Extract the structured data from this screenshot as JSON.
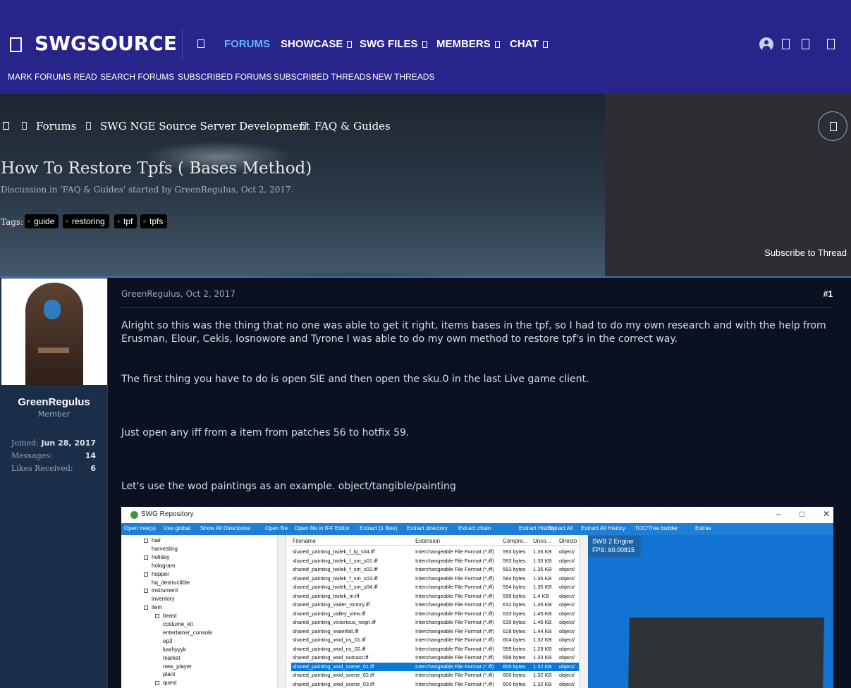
{
  "header": {
    "logo": "SWGSOURCE",
    "nav": [
      {
        "label": "FORUMS",
        "active": true,
        "has_menu": false
      },
      {
        "label": "SHOWCASE",
        "active": false,
        "has_menu": true
      },
      {
        "label": "SWG FILES",
        "active": false,
        "has_menu": true
      },
      {
        "label": "MEMBERS",
        "active": false,
        "has_menu": true
      },
      {
        "label": "CHAT",
        "active": false,
        "has_menu": true
      }
    ],
    "subnav": [
      "MARK FORUMS READ",
      "SEARCH FORUMS",
      "SUBSCRIBED FORUMS",
      "SUBSCRIBED THREADS",
      "NEW THREADS"
    ],
    "icons": [
      "user-avatar",
      "inbox-icon",
      "alerts-icon",
      "search-icon"
    ]
  },
  "breadcrumbs": [
    "Forums",
    "SWG NGE Source Server Development",
    "FAQ & Guides"
  ],
  "thread": {
    "title": "How To Restore Tpfs ( Bases Method)",
    "meta": "Discussion in 'FAQ & Guides' started by GreenRegulus, Oct 2, 2017.",
    "tags_label": "Tags:",
    "tags": [
      "guide",
      "restoring",
      "tpf",
      "tpfs"
    ],
    "subscribe": "Subscribe to Thread"
  },
  "post": {
    "user": {
      "name": "GreenRegulus",
      "title": "Member",
      "stats": [
        {
          "label": "Joined:",
          "value": "Jun 28, 2017"
        },
        {
          "label": "Messages:",
          "value": "14"
        },
        {
          "label": "Likes Received:",
          "value": "6"
        }
      ]
    },
    "author_line": "GreenRegulus, Oct 2, 2017",
    "number": "#1",
    "paragraphs": [
      "Alright so this was the thing that no one was able to get it right, items bases in the tpf, so I had to do my own research and with the help from Erusman, Elour, Cekis, Iosnowore and Tyrone I was able to do my own method to restore tpf's in the correct way.",
      "The first thing you have to do is open SIE and then open the sku.0 in the last Live game client.",
      "Just open any iff from a item from patches 56 to hotfix 59.",
      "Let's use the wod paintings as an example. object/tangible/painting"
    ]
  },
  "repo_window": {
    "title": "SWG Repository",
    "controls": [
      "–",
      "□",
      "✕"
    ],
    "toolbar": [
      "Open tree(s)",
      "Use global",
      "Show All Directories",
      "Open file",
      "Open file in IFF Editor",
      "Extract (1 files)",
      "Extract directory",
      "Extract chain",
      "Extract History",
      "Extract All",
      "Extract All History",
      "TOC/Tree builder",
      "Extras"
    ],
    "tree": [
      {
        "label": "hair",
        "expandable": true,
        "indent": 1
      },
      {
        "label": "harvesting",
        "expandable": false,
        "indent": 1
      },
      {
        "label": "holiday",
        "expandable": true,
        "indent": 1
      },
      {
        "label": "hologram",
        "expandable": false,
        "indent": 1
      },
      {
        "label": "hopper",
        "expandable": true,
        "indent": 1
      },
      {
        "label": "hq_destructible",
        "expandable": false,
        "indent": 1
      },
      {
        "label": "instrument",
        "expandable": true,
        "indent": 1
      },
      {
        "label": "inventory",
        "expandable": false,
        "indent": 1
      },
      {
        "label": "item",
        "expandable": true,
        "indent": 1
      },
      {
        "label": "beast",
        "expandable": true,
        "indent": 2
      },
      {
        "label": "costume_kit",
        "expandable": false,
        "indent": 2
      },
      {
        "label": "entertainer_console",
        "expandable": false,
        "indent": 2
      },
      {
        "label": "ep3",
        "expandable": false,
        "indent": 2
      },
      {
        "label": "kashyyyk",
        "expandable": false,
        "indent": 2
      },
      {
        "label": "market",
        "expandable": false,
        "indent": 2
      },
      {
        "label": "new_player",
        "expandable": false,
        "indent": 2
      },
      {
        "label": "plant",
        "expandable": false,
        "indent": 2
      },
      {
        "label": "quest",
        "expandable": true,
        "indent": 2
      }
    ],
    "columns": [
      "Filename",
      "Extension",
      "Compre...",
      "Unco...",
      "Directo"
    ],
    "rows": [
      [
        "shared_painting_twilek_f_lg_s04.iff",
        "Interchangeable File Format (*.iff)",
        "593 bytes",
        "1.35 KB",
        "object/"
      ],
      [
        "shared_painting_twilek_f_sm_s01.iff",
        "Interchangeable File Format (*.iff)",
        "593 bytes",
        "1.35 KB",
        "object/"
      ],
      [
        "shared_painting_twilek_f_sm_s02.iff",
        "Interchangeable File Format (*.iff)",
        "593 bytes",
        "1.35 KB",
        "object/"
      ],
      [
        "shared_painting_twilek_f_sm_s03.iff",
        "Interchangeable File Format (*.iff)",
        "594 bytes",
        "1.35 KB",
        "object/"
      ],
      [
        "shared_painting_twilek_f_sm_s04.iff",
        "Interchangeable File Format (*.iff)",
        "594 bytes",
        "1.35 KB",
        "object/"
      ],
      [
        "shared_painting_twilek_m.iff",
        "Interchangeable File Format (*.iff)",
        "599 bytes",
        "1.4 KB",
        "object/"
      ],
      [
        "shared_painting_vader_victory.iff",
        "Interchangeable File Format (*.iff)",
        "632 bytes",
        "1.45 KB",
        "object/"
      ],
      [
        "shared_painting_valley_view.iff",
        "Interchangeable File Format (*.iff)",
        "633 bytes",
        "1.45 KB",
        "object/"
      ],
      [
        "shared_painting_victorious_reign.iff",
        "Interchangeable File Format (*.iff)",
        "630 bytes",
        "1.46 KB",
        "object/"
      ],
      [
        "shared_painting_waterfall.iff",
        "Interchangeable File Format (*.iff)",
        "628 bytes",
        "1.44 KB",
        "object/"
      ],
      [
        "shared_painting_wod_ns_01.iff",
        "Interchangeable File Format (*.iff)",
        "604 bytes",
        "1.32 KB",
        "object/"
      ],
      [
        "shared_painting_wod_ns_02.iff",
        "Interchangeable File Format (*.iff)",
        "599 bytes",
        "1.29 KB",
        "object/"
      ],
      [
        "shared_painting_wod_outcast.iff",
        "Interchangeable File Format (*.iff)",
        "599 bytes",
        "1.33 KB",
        "object/"
      ],
      [
        "shared_painting_wod_scene_01.iff",
        "Interchangeable File Format (*.iff)",
        "600 bytes",
        "1.32 KB",
        "object/"
      ],
      [
        "shared_painting_wod_scene_02.iff",
        "Interchangeable File Format (*.iff)",
        "600 bytes",
        "1.32 KB",
        "object/"
      ],
      [
        "shared_painting_wod_scene_03.iff",
        "Interchangeable File Format (*.iff)",
        "600 bytes",
        "1.32 KB",
        "object/"
      ]
    ],
    "selected_row": 13,
    "engine_label": "SWB 2 Engine",
    "engine_fps": "FPS: 60.00815"
  },
  "colors": {
    "header_bg": "#27258a",
    "nav_active": "#5fb7ff",
    "page_bg": "#0b1120",
    "user_column_bg": "#1a2d49",
    "post_border": "#3c73ad",
    "repo_accent": "#1e7fd6"
  }
}
